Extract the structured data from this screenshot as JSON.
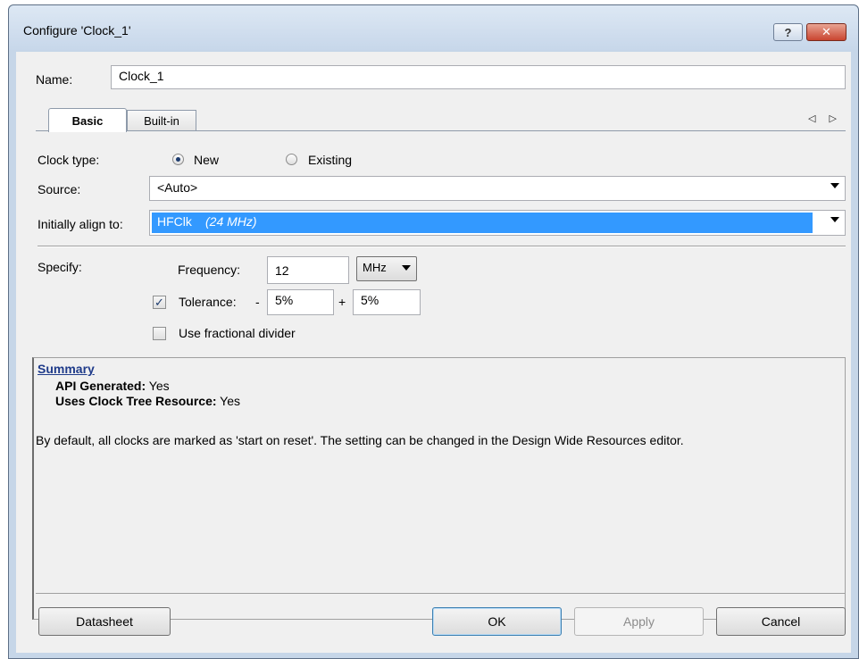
{
  "window": {
    "title": "Configure 'Clock_1'",
    "help_label": "?",
    "close_label": "✕"
  },
  "name_row": {
    "label": "Name:",
    "value": "Clock_1"
  },
  "tabs": [
    {
      "label": "Basic",
      "active": true
    },
    {
      "label": "Built-in",
      "active": false
    }
  ],
  "tab_nav": "◁ ▷",
  "basic": {
    "clock_type_label": "Clock type:",
    "clock_type_options": [
      {
        "label": "New",
        "selected": true
      },
      {
        "label": "Existing",
        "selected": false
      }
    ],
    "source_label": "Source:",
    "source_value": "<Auto>",
    "align_label": "Initially align to:",
    "align_value": "HFClk",
    "align_value_note": "(24 MHz)",
    "specify_label": "Specify:",
    "frequency_label": "Frequency:",
    "frequency_value": "12",
    "frequency_unit": "MHz",
    "tolerance_label": "Tolerance:",
    "tolerance_checked": true,
    "tolerance_minus_sign": "-",
    "tolerance_minus": "5%",
    "tolerance_plus_sign": "+",
    "tolerance_plus": "5%",
    "fractional_label": "Use fractional divider",
    "fractional_checked": false
  },
  "summary": {
    "link": "Summary",
    "api_generated_label": "API Generated:",
    "api_generated_value": "Yes",
    "clock_tree_label": "Uses Clock Tree Resource:",
    "clock_tree_value": "Yes",
    "note": "By default, all clocks are marked as 'start on reset'. The setting can be changed in the Design Wide Resources editor."
  },
  "buttons": {
    "datasheet": "Datasheet",
    "ok": "OK",
    "apply": "Apply",
    "cancel": "Cancel"
  },
  "colors": {
    "selection": "#3399ff",
    "link": "#1f3b8a"
  }
}
